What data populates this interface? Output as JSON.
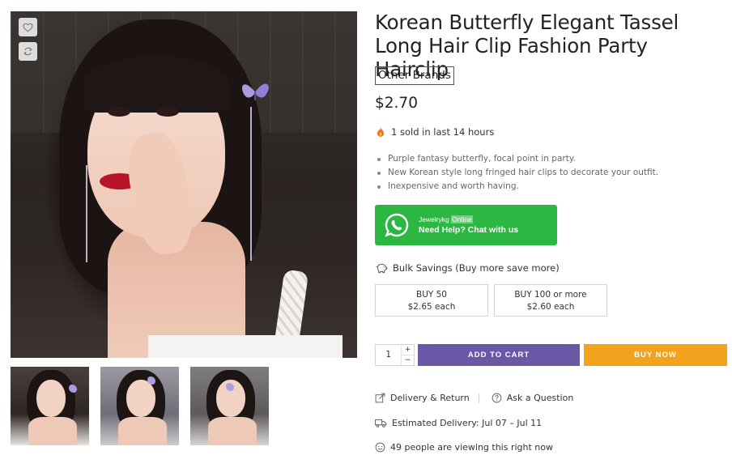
{
  "product": {
    "title": "Korean Butterfly Elegant Tassel Long Hair Clip Fashion Party Hairclip",
    "brand": "Other Brands",
    "price": "$2.70",
    "sold_text": "1 sold in last 14 hours",
    "bullets": [
      "Purple fantasy butterfly, focal point in party.",
      "New Korean style long fringed hair clips to decorate your outfit.",
      "Inexpensive and worth having."
    ]
  },
  "gallery": {
    "thumbnails": [
      "thumbnail-1",
      "thumbnail-2",
      "thumbnail-3"
    ],
    "icons": {
      "wishlist": "heart-icon",
      "compare": "refresh-icon"
    }
  },
  "whatsapp": {
    "agent_name": "Jewelrykg",
    "status": "Online",
    "cta": "Need Help? Chat with us",
    "color": "#2cb742"
  },
  "bulk": {
    "label": "Bulk Savings (Buy more save more)",
    "tiers": [
      {
        "qty_label": "BUY 50",
        "price_label": "$2.65 each"
      },
      {
        "qty_label": "BUY 100 or more",
        "price_label": "$2.60 each"
      }
    ]
  },
  "cart": {
    "quantity": "1",
    "plus": "+",
    "minus": "−",
    "add_to_cart_label": "ADD TO CART",
    "buy_now_label": "BUY NOW",
    "add_color": "#6a58a6",
    "buy_color": "#f2a21c"
  },
  "meta": {
    "delivery_return": "Delivery & Return",
    "ask_question": "Ask a Question",
    "estimated_delivery": "Estimated Delivery: Jul 07 – Jul 11",
    "viewing": "49 people are viewing this right now"
  }
}
